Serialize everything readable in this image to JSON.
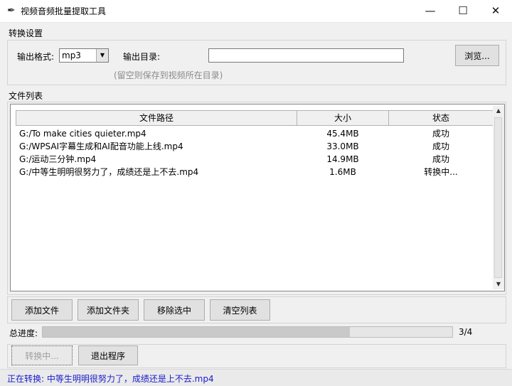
{
  "window": {
    "title": "视频音频批量提取工具"
  },
  "settings": {
    "section_label": "转换设置",
    "format_label": "输出格式:",
    "format_value": "mp3",
    "dir_label": "输出目录:",
    "dir_value": "",
    "browse_label": "浏览...",
    "hint": "(留空则保存到视频所在目录)"
  },
  "files": {
    "section_label": "文件列表",
    "columns": [
      "文件路径",
      "大小",
      "状态"
    ],
    "rows": [
      {
        "path": "G:/To make cities quieter.mp4",
        "size": "45.4MB",
        "status": "成功"
      },
      {
        "path": "G:/WPSAI字幕生成和AI配音功能上线.mp4",
        "size": "33.0MB",
        "status": "成功"
      },
      {
        "path": "G:/运动三分钟.mp4",
        "size": "14.9MB",
        "status": "成功"
      },
      {
        "path": "G:/中等生明明很努力了，成绩还是上不去.mp4",
        "size": "1.6MB",
        "status": "转换中..."
      }
    ]
  },
  "actions": {
    "add_file": "添加文件",
    "add_folder": "添加文件夹",
    "remove_selected": "移除选中",
    "clear_list": "清空列表"
  },
  "progress": {
    "label": "总进度:",
    "text": "3/4",
    "fraction": 0.75
  },
  "controls": {
    "convert": "转换中...",
    "exit": "退出程序"
  },
  "status": {
    "text": "正在转换: 中等生明明很努力了，成绩还是上不去.mp4"
  },
  "colors": {
    "status_text": "#1a1acc"
  }
}
